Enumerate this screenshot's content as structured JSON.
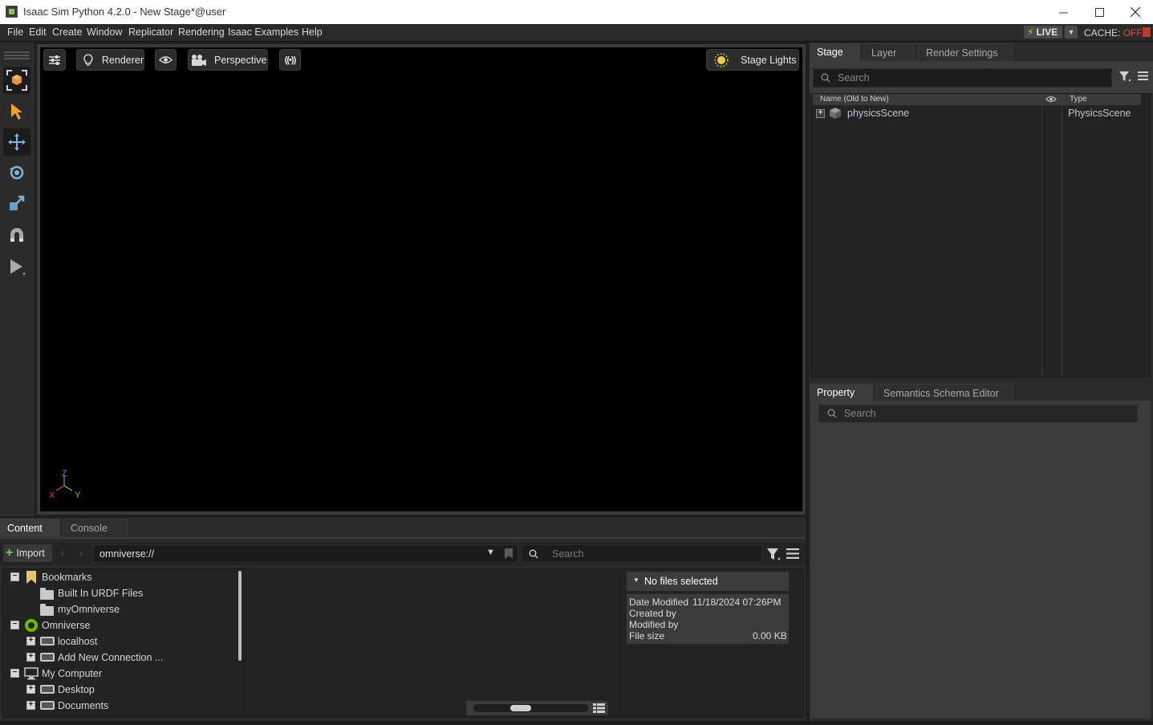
{
  "window": {
    "title": "Isaac Sim Python 4.2.0 - New Stage*@user",
    "minimize_icon": "minimize-icon",
    "maximize_icon": "maximize-icon",
    "close_icon": "close-icon"
  },
  "menu": {
    "items": [
      "File",
      "Edit",
      "Create",
      "Window",
      "Replicator",
      "Rendering",
      "Isaac Examples",
      "Help"
    ],
    "live_label": "LIVE",
    "cache_label": "CACHE:",
    "cache_state": "OFF"
  },
  "viewport": {
    "settings_icon": "sliders-icon",
    "renderer_label": "Renderer",
    "visibility_icon": "eye-icon",
    "camera_label": "Perspective",
    "broadcast_icon": "broadcast-icon",
    "lights_label": "Stage Lights",
    "axis": {
      "z": "Z",
      "x": "X",
      "y": "Y"
    },
    "colors": {
      "x": "#d04a4a",
      "y": "#7fbf5a",
      "z": "#5a8fd6"
    }
  },
  "tools": [
    "select-mode-icon",
    "arrow-pointer-icon",
    "move-icon",
    "rotate-icon",
    "scale-icon",
    "snap-magnet-icon",
    "play-icon"
  ],
  "stage": {
    "tabs": [
      "Stage",
      "Layer",
      "Render Settings"
    ],
    "search_placeholder": "Search",
    "columns": {
      "name": "Name (Old to New)",
      "type": "Type"
    },
    "rows": [
      {
        "name": "physicsScene",
        "type": "PhysicsScene"
      }
    ]
  },
  "property": {
    "tabs": [
      "Property",
      "Semantics Schema Editor"
    ],
    "search_placeholder": "Search"
  },
  "content": {
    "tabs": [
      "Content",
      "Console"
    ],
    "import_label": "Import",
    "path": "omniverse://",
    "search_placeholder": "Search",
    "tree": [
      {
        "label": "Bookmarks",
        "level": 0,
        "expander": "−",
        "icon": "bookmark-icon"
      },
      {
        "label": "Built In URDF Files",
        "level": 1,
        "expander": "",
        "icon": "folder-icon"
      },
      {
        "label": "myOmniverse",
        "level": 1,
        "expander": "",
        "icon": "folder-icon"
      },
      {
        "label": "Omniverse",
        "level": 0,
        "expander": "−",
        "icon": "omniverse-icon"
      },
      {
        "label": "localhost",
        "level": 1,
        "expander": "+",
        "icon": "server-icon"
      },
      {
        "label": "Add New Connection ...",
        "level": 1,
        "expander": "+",
        "icon": "add-connection-icon"
      },
      {
        "label": "My Computer",
        "level": 0,
        "expander": "−",
        "icon": "computer-icon"
      },
      {
        "label": "Desktop",
        "level": 1,
        "expander": "+",
        "icon": "drive-icon"
      },
      {
        "label": "Documents",
        "level": 1,
        "expander": "+",
        "icon": "drive-icon"
      }
    ],
    "details": {
      "header": "No files selected",
      "date_modified_label": "Date Modified",
      "date_modified_value": "11/18/2024 07:26PM",
      "created_by_label": "Created by",
      "modified_by_label": "Modified by",
      "file_size_label": "File size",
      "file_size_value": "0.00 KB"
    }
  }
}
